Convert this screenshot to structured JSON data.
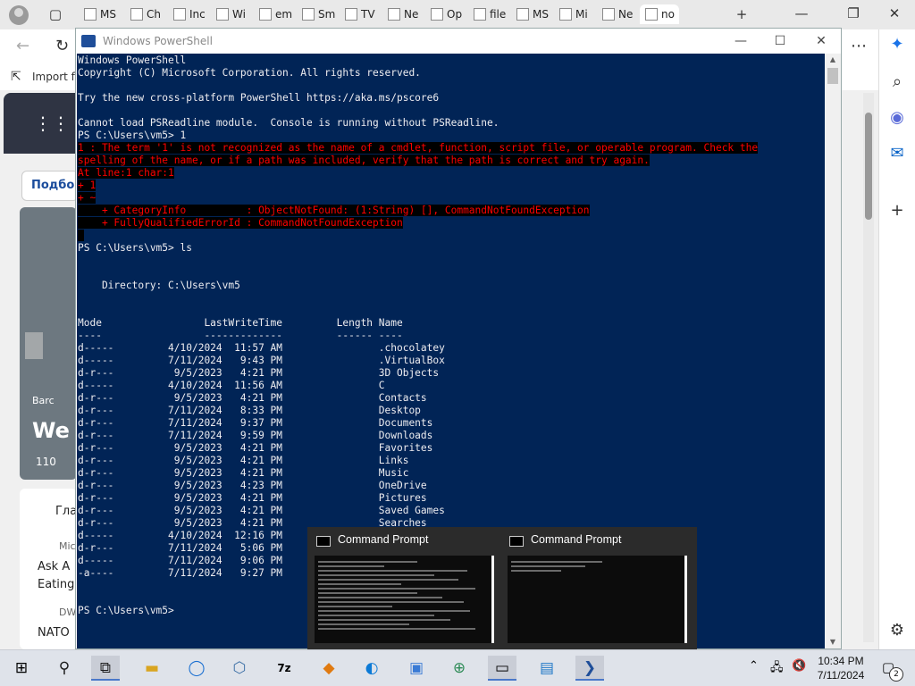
{
  "browser": {
    "tabs": [
      {
        "label": "MS"
      },
      {
        "label": "Ch"
      },
      {
        "label": "Inc"
      },
      {
        "label": "Wi"
      },
      {
        "label": "em"
      },
      {
        "label": "Sm"
      },
      {
        "label": "TV"
      },
      {
        "label": "Ne"
      },
      {
        "label": "Op"
      },
      {
        "label": "file"
      },
      {
        "label": "MS"
      },
      {
        "label": "Mi"
      },
      {
        "label": "Ne"
      },
      {
        "label": "no"
      }
    ],
    "new_tab": "+",
    "favorites_label": "Import fa",
    "page_fragments": {
      "podbor": "Подбор",
      "bard": "Barc",
      "we": "We",
      "likes": "110",
      "gla": "Гла",
      "mic": "Mic",
      "ask": "Ask A",
      "eating": "Eating",
      "dw": "DW",
      "nato": "NATO"
    }
  },
  "powershell": {
    "window_title": "Windows PowerShell",
    "lines": [
      {
        "t": "Windows PowerShell",
        "err": false
      },
      {
        "t": "Copyright (C) Microsoft Corporation. All rights reserved.",
        "err": false
      },
      {
        "t": "",
        "err": false
      },
      {
        "t": "Try the new cross-platform PowerShell https://aka.ms/pscore6",
        "err": false
      },
      {
        "t": "",
        "err": false
      },
      {
        "t": "Cannot load PSReadline module.  Console is running without PSReadline.",
        "err": false
      },
      {
        "t": "PS C:\\Users\\vm5> 1",
        "err": false
      },
      {
        "t": "1 : The term '1' is not recognized as the name of a cmdlet, function, script file, or operable program. Check the",
        "err": true
      },
      {
        "t": "spelling of the name, or if a path was included, verify that the path is correct and try again.",
        "err": true
      },
      {
        "t": "At line:1 char:1",
        "err": true
      },
      {
        "t": "+ 1",
        "err": true
      },
      {
        "t": "+ ~",
        "err": true
      },
      {
        "t": "    + CategoryInfo          : ObjectNotFound: (1:String) [], CommandNotFoundException",
        "err": true
      },
      {
        "t": "    + FullyQualifiedErrorId : CommandNotFoundException",
        "err": true
      },
      {
        "t": " ",
        "err": true
      },
      {
        "t": "PS C:\\Users\\vm5> ls",
        "err": false
      },
      {
        "t": "",
        "err": false
      },
      {
        "t": "",
        "err": false
      },
      {
        "t": "    Directory: C:\\Users\\vm5",
        "err": false
      },
      {
        "t": "",
        "err": false
      },
      {
        "t": "",
        "err": false
      },
      {
        "t": "Mode                 LastWriteTime         Length Name",
        "err": false
      },
      {
        "t": "----                 -------------         ------ ----",
        "err": false
      },
      {
        "t": "d-----         4/10/2024  11:57 AM                .chocolatey",
        "err": false
      },
      {
        "t": "d-----         7/11/2024   9:43 PM                .VirtualBox",
        "err": false
      },
      {
        "t": "d-r---          9/5/2023   4:21 PM                3D Objects",
        "err": false
      },
      {
        "t": "d-----         4/10/2024  11:56 AM                C",
        "err": false
      },
      {
        "t": "d-r---          9/5/2023   4:21 PM                Contacts",
        "err": false
      },
      {
        "t": "d-r---         7/11/2024   8:33 PM                Desktop",
        "err": false
      },
      {
        "t": "d-r---         7/11/2024   9:37 PM                Documents",
        "err": false
      },
      {
        "t": "d-r---         7/11/2024   9:59 PM                Downloads",
        "err": false
      },
      {
        "t": "d-r---          9/5/2023   4:21 PM                Favorites",
        "err": false
      },
      {
        "t": "d-r---          9/5/2023   4:21 PM                Links",
        "err": false
      },
      {
        "t": "d-r---          9/5/2023   4:21 PM                Music",
        "err": false
      },
      {
        "t": "d-r---          9/5/2023   4:23 PM                OneDrive",
        "err": false
      },
      {
        "t": "d-r---          9/5/2023   4:21 PM                Pictures",
        "err": false
      },
      {
        "t": "d-r---          9/5/2023   4:21 PM                Saved Games",
        "err": false
      },
      {
        "t": "d-r---          9/5/2023   4:21 PM                Searches",
        "err": false
      },
      {
        "t": "d-----         4/10/2024  12:16 PM",
        "err": false
      },
      {
        "t": "d-r---         7/11/2024   5:06 PM",
        "err": false
      },
      {
        "t": "d-----         7/11/2024   9:06 PM",
        "err": false
      },
      {
        "t": "-a----         7/11/2024   9:27 PM",
        "err": false
      },
      {
        "t": "",
        "err": false
      },
      {
        "t": "",
        "err": false
      },
      {
        "t": "PS C:\\Users\\vm5>",
        "err": false
      }
    ]
  },
  "task_thumbnails": [
    {
      "title": "Command Prompt"
    },
    {
      "title": "Command Prompt"
    }
  ],
  "taskbar": {
    "time": "10:34 PM",
    "date": "7/11/2024",
    "notification_count": "2",
    "icons": [
      "start-icon",
      "search-icon",
      "task-view-icon",
      "file-explorer-icon",
      "chromium-icon",
      "virtualbox-icon",
      "7zip-icon",
      "pinned-app-icon",
      "edge-icon",
      "control-panel-icon",
      "network-globe-icon",
      "command-prompt-icon",
      "remote-desktop-icon",
      "powershell-icon"
    ]
  },
  "colors": {
    "ps_background": "#012456",
    "ps_text": "#eeedf0",
    "ps_error_text": "#ff0000",
    "ps_error_bg": "#000000",
    "taskbar": "#dfe3ea"
  }
}
